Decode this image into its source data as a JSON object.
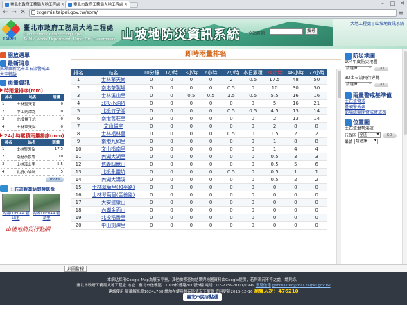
{
  "browser": {
    "tabs": [
      {
        "title": "臺北市政府工務局大地工程處"
      },
      {
        "title": "臺北市政府工務局大地工程處"
      }
    ],
    "url": "tcgemis.taipei.gov.tw/sora/",
    "window_controls": [
      "–",
      "□",
      "✕"
    ]
  },
  "banner": {
    "logo_text": "TAIPEI",
    "agency_name": "臺北市政府工務局大地工程處",
    "agency_en_1": "Geotechnical Engineering Office",
    "agency_en_2": "Public Works Department, Taipei City Government",
    "system_title": "山坡地防災資訊系統",
    "top_links": [
      "大地工程處",
      "山坡地資訊系統"
    ],
    "site_search_label": "全站查詢：",
    "site_search_button": "搜尋"
  },
  "left": {
    "menu_title": "開放選單",
    "news_title": "最新消息",
    "news_items": [
      "民眾由新北市土石流警戒區",
      "大屯特訴"
    ],
    "rain_title": "雨量資訊",
    "hourly_head": "時雨量排序(mm)",
    "hourly_cols": [
      "排名",
      "站名",
      "雨量"
    ],
    "hourly_rows": [
      [
        "1",
        "士林聖天宮",
        "0"
      ],
      [
        "2",
        "中山劍潭路",
        "0"
      ],
      [
        "3",
        "北投貴子坑",
        "0"
      ],
      [
        "4",
        "士林擎天崗",
        "0"
      ]
    ],
    "daily_head": "24小時累積雨量排序(mm)",
    "daily_cols": [
      "排名",
      "站名",
      "雨量"
    ],
    "daily_rows": [
      [
        "1",
        "士林聖天崗",
        "17.5"
      ],
      [
        "2",
        "南港茶製場",
        "10"
      ],
      [
        "3",
        "士林溪山里",
        "5.5"
      ],
      [
        "4",
        "北投小油坑",
        "5"
      ]
    ],
    "more_label": "more",
    "cam_title": "土石流觀測站即時影像",
    "cams": [
      "內湖LDF044 碧山里",
      "內湖LDF044 碧湖里"
    ],
    "slogan": "山坡地防災行動網"
  },
  "main": {
    "title": "即時雨量排名",
    "columns": [
      "排名",
      "站名",
      "10分鐘",
      "1小時",
      "3小時",
      "6小時",
      "12小時",
      "本日累積",
      "24小時",
      "48小時",
      "72小時"
    ],
    "highlight_col": 8,
    "rows": [
      [
        "1",
        "士林擎天崗",
        "0",
        "0",
        "0",
        "0",
        "2",
        "0.5",
        "17.5",
        "48",
        "50"
      ],
      [
        "2",
        "南港茶製場",
        "0",
        "0",
        "0",
        "0",
        "0.5",
        "0",
        "10",
        "30",
        "30"
      ],
      [
        "3",
        "士林溪山里",
        "0",
        "0",
        "0.5",
        "0.5",
        "1.5",
        "0.5",
        "5.5",
        "16",
        "16"
      ],
      [
        "4",
        "北投小油坑",
        "0",
        "0",
        "0",
        "0",
        "0",
        "0",
        "5",
        "16",
        "21"
      ],
      [
        "5",
        "北投竹子湖",
        "0",
        "0",
        "0",
        "0",
        "0.5",
        "0.5",
        "4.5",
        "13",
        "14"
      ],
      [
        "6",
        "南港舊莊里",
        "0",
        "0",
        "0",
        "0",
        "0",
        "0",
        "2",
        "13",
        "14"
      ],
      [
        "7",
        "文山猫空",
        "0",
        "0",
        "0",
        "0",
        "0",
        "0",
        "2",
        "8",
        "8"
      ],
      [
        "8",
        "士林福林里",
        "0",
        "0",
        "0",
        "0",
        "0.5",
        "0",
        "1.5",
        "2",
        "2"
      ],
      [
        "9",
        "南港九如里",
        "0",
        "0",
        "0",
        "0",
        "0",
        "0",
        "1",
        "8",
        "8"
      ],
      [
        "10",
        "文山指南里",
        "0",
        "0",
        "0",
        "0",
        "0",
        "0",
        "1",
        "4",
        "4"
      ],
      [
        "11",
        "內湖大湖里",
        "0",
        "0",
        "0",
        "0",
        "0",
        "0",
        "0.5",
        "3",
        "3"
      ],
      [
        "12",
        "信義四獸山",
        "0",
        "0",
        "0",
        "0",
        "0",
        "0",
        "0.5",
        "5",
        "6"
      ],
      [
        "13",
        "北投永靈坑",
        "0",
        "0",
        "0",
        "0",
        "0.5",
        "0",
        "0.5",
        "1",
        "1"
      ],
      [
        "14",
        "內湖大溝溪",
        "0",
        "0",
        "0",
        "0",
        "0",
        "0",
        "0.5",
        "2",
        "2"
      ],
      [
        "15",
        "士林翠菊里(和平路)",
        "0",
        "0",
        "0",
        "0",
        "0",
        "0",
        "0",
        "0",
        "0"
      ],
      [
        "16",
        "士林翠菊里(至善路)",
        "0",
        "0",
        "0",
        "0",
        "0",
        "0",
        "0",
        "0",
        "0"
      ],
      [
        "17",
        "大安建康山",
        "0",
        "0",
        "0",
        "0",
        "0",
        "0",
        "0",
        "0",
        "0"
      ],
      [
        "18",
        "內湖金面山",
        "0",
        "0",
        "0",
        "0",
        "0",
        "0",
        "0",
        "0",
        "0"
      ],
      [
        "19",
        "北投稻香里",
        "0",
        "0",
        "0",
        "0",
        "0",
        "0",
        "0",
        "0",
        "0"
      ],
      [
        "20",
        "中山劍潭里",
        "0",
        "0",
        "0",
        "0",
        "0",
        "0",
        "0",
        "0",
        "0"
      ]
    ]
  },
  "right": {
    "map_title": "防災地圖",
    "map_year": "104年度防災地圖",
    "select_default": "請選擇",
    "go_label": "GO",
    "flight_label": "3D土石流飛行導覽",
    "alert_title": "雨量警戒基準值",
    "alert_links": [
      "土石流警戒",
      "堅硬警戒表",
      "邵陽繪擊開警戒警戒表"
    ],
    "position_title": "位置圖",
    "depth_label": "土石流潛勢溪流",
    "district_label": "行政區",
    "district_value": "全區",
    "number_label": "編號",
    "number_value": "請選擇"
  },
  "bottom_tab": "地圖監視",
  "footer": {
    "line1": "本網站採用Google Map為展示平臺，其他檢索查詢結果與地圖資料由Google提供，若與現況不符之處，請見諒。",
    "line2_prefix": "臺北市政府工務局大地工程處 地址：臺北市信義區 11008松德路300號3樓 電話：02-2759-3001/1999",
    "line2_link_label": "意見信箱",
    "line2_link": "gebmaster@mail.taipei.gov.tw",
    "line3_prefix": "建議使用 螢幕解析度1024x768 請勿在使用暫存區情況下瀏覽 資料更新2015-12-16",
    "counter_label": "瀏覽人次：476210",
    "badge": "臺北市民@點通"
  }
}
